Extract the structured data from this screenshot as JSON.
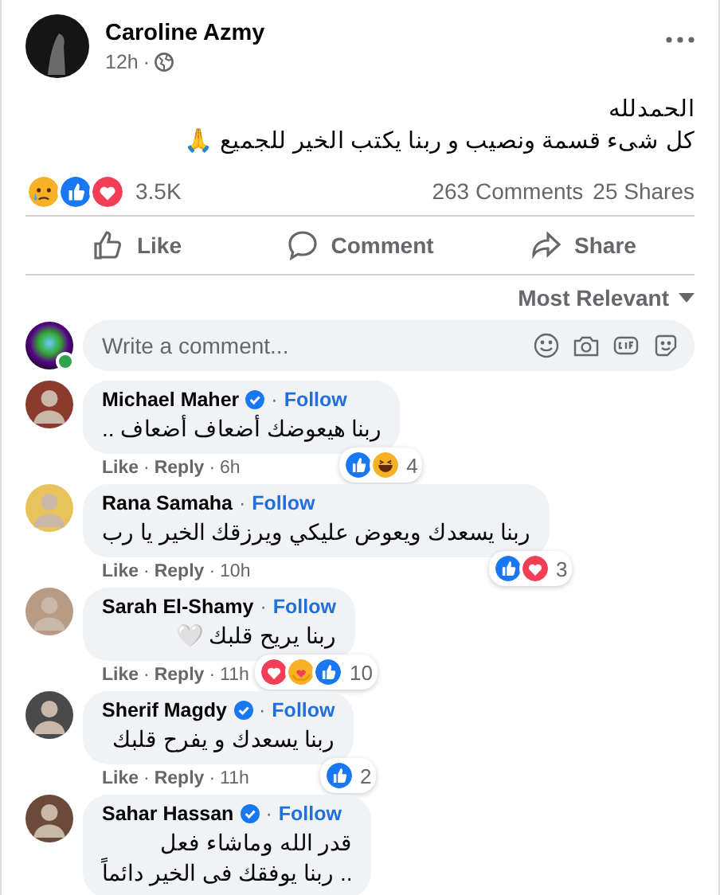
{
  "separator": "·",
  "post": {
    "author": "Caroline Azmy",
    "time": "12h",
    "lines": [
      "الحمدلله",
      "كل شىء قسمة ونصيب و ربنا يكتب الخير للجميع 🙏"
    ],
    "reactions": [
      {
        "kind": "sad"
      },
      {
        "kind": "like"
      },
      {
        "kind": "love"
      }
    ],
    "reaction_count": "3.5K",
    "comments_count": "263 Comments",
    "shares_count": "25 Shares"
  },
  "actions": [
    {
      "kind": "like",
      "label": "Like"
    },
    {
      "kind": "comment",
      "label": "Comment"
    },
    {
      "kind": "share",
      "label": "Share"
    }
  ],
  "sort": {
    "label": "Most Relevant"
  },
  "composer": {
    "placeholder": "Write a comment...",
    "online": true
  },
  "comments": [
    {
      "name": "Michael Maher",
      "verified": true,
      "follow": "Follow",
      "lines": [
        "ربنا هيعوضك أضعاف أضعاف .."
      ],
      "reactions": [
        {
          "kind": "like"
        },
        {
          "kind": "haha"
        }
      ],
      "count": "4",
      "like": "Like",
      "reply": "Reply",
      "time": "6h"
    },
    {
      "name": "Rana Samaha",
      "verified": false,
      "follow": "Follow",
      "lines": [
        "ربنا يسعدك ويعوض عليكي ويرزقك الخير يا رب"
      ],
      "reactions": [
        {
          "kind": "like"
        },
        {
          "kind": "love"
        }
      ],
      "count": "3",
      "like": "Like",
      "reply": "Reply",
      "time": "10h"
    },
    {
      "name": "Sarah El-Shamy",
      "verified": false,
      "follow": "Follow",
      "lines": [
        "ربنا يريح قلبك 🤍"
      ],
      "reactions": [
        {
          "kind": "love"
        },
        {
          "kind": "care"
        },
        {
          "kind": "like"
        }
      ],
      "count": "10",
      "like": "Like",
      "reply": "Reply",
      "time": "11h"
    },
    {
      "name": "Sherif Magdy",
      "verified": true,
      "follow": "Follow",
      "lines": [
        "ربنا يسعدك و يفرح قلبك"
      ],
      "reactions": [
        {
          "kind": "like"
        }
      ],
      "count": "2",
      "like": "Like",
      "reply": "Reply",
      "time": "11h"
    },
    {
      "name": "Sahar Hassan",
      "verified": true,
      "follow": "Follow",
      "lines": [
        "قدر الله وماشاء فعل",
        ".. ربنا يوفقك فى الخير دائماً"
      ]
    }
  ]
}
